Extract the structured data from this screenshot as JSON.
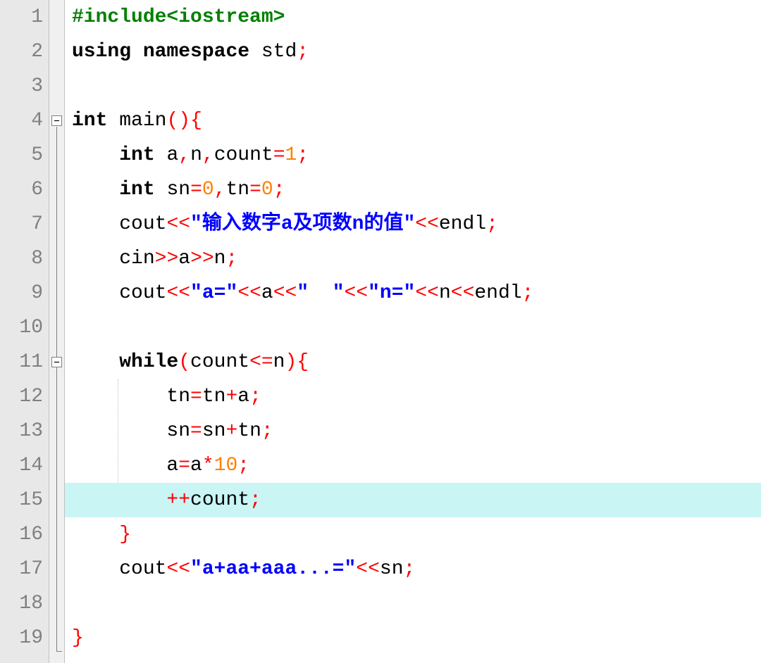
{
  "editor": {
    "highlighted_line": 15,
    "lines": {
      "l1": {
        "num": "1"
      },
      "l2": {
        "num": "2"
      },
      "l3": {
        "num": "3"
      },
      "l4": {
        "num": "4"
      },
      "l5": {
        "num": "5"
      },
      "l6": {
        "num": "6"
      },
      "l7": {
        "num": "7"
      },
      "l8": {
        "num": "8"
      },
      "l9": {
        "num": "9"
      },
      "l10": {
        "num": "10"
      },
      "l11": {
        "num": "11"
      },
      "l12": {
        "num": "12"
      },
      "l13": {
        "num": "13"
      },
      "l14": {
        "num": "14"
      },
      "l15": {
        "num": "15"
      },
      "l16": {
        "num": "16"
      },
      "l17": {
        "num": "17"
      },
      "l18": {
        "num": "18"
      },
      "l19": {
        "num": "19"
      }
    },
    "tokens": {
      "include": "#include<iostream>",
      "using": "using",
      "namespace": "namespace",
      "std": "std",
      "int": "int",
      "main": "main",
      "a": "a",
      "n": "n",
      "count": "count",
      "sn": "sn",
      "tn": "tn",
      "cout": "cout",
      "cin": "cin",
      "endl": "endl",
      "while": "while",
      "str1": "\"输入数字a及项数n的值\"",
      "str2": "\"a=\"",
      "str3": "\"  \"",
      "str4": "\"n=\"",
      "str5": "\"a+aa+aaa...=\"",
      "n0": "0",
      "n1": "1",
      "n10": "10",
      "lparen": "(",
      "rparen": ")",
      "lbrace": "{",
      "rbrace": "}",
      "comma": ",",
      "semi": ";",
      "eq": "=",
      "plus": "+",
      "star": "*",
      "lt": "<",
      "gt": ">",
      "lshift": "<<",
      "rshift": ">>",
      "lte": "<=",
      "preinc": "++",
      "space": " "
    },
    "fold": {
      "minus": "⊟"
    }
  }
}
